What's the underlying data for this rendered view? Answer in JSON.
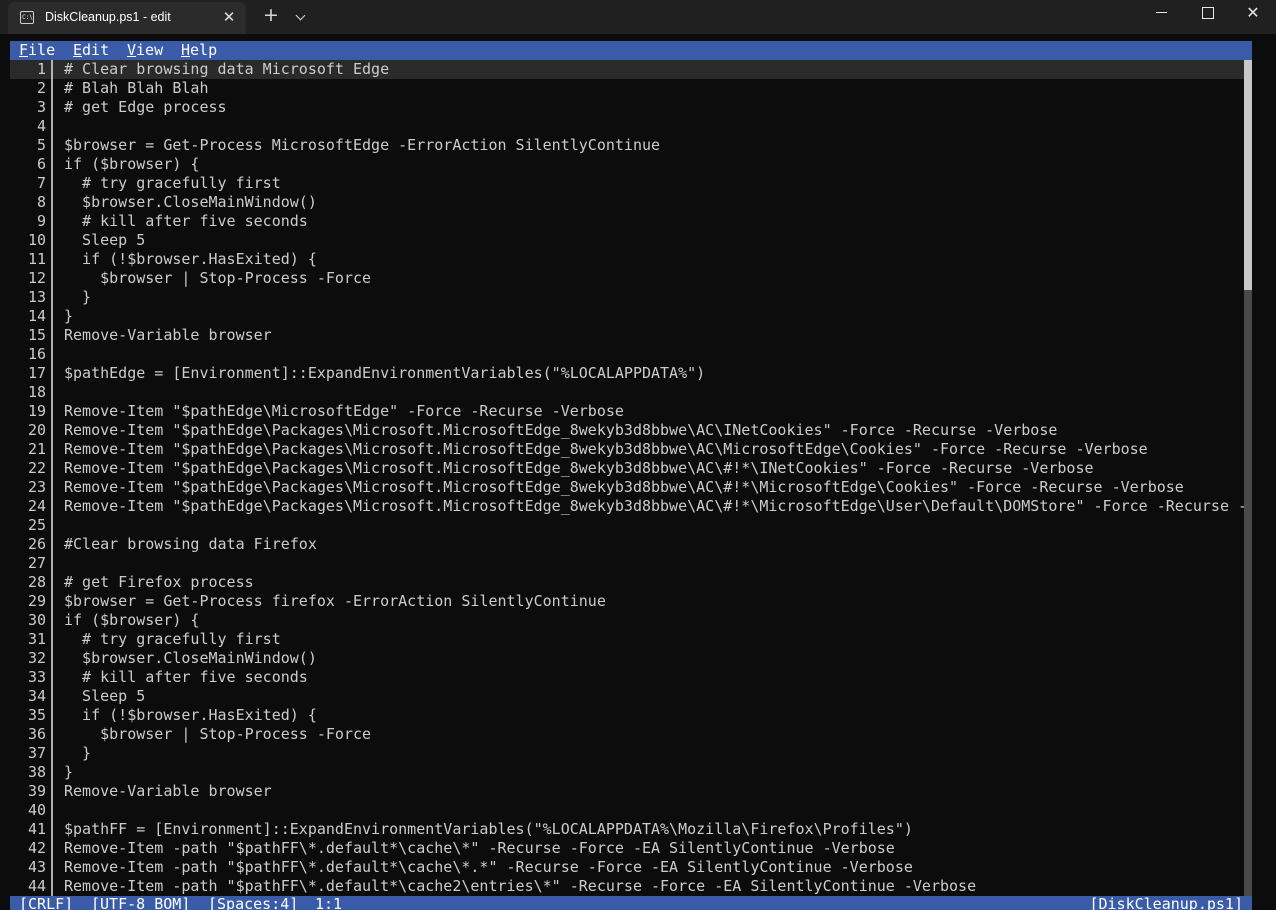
{
  "window": {
    "tab_title": "DiskCleanup.ps1 - edit",
    "tab_icon_text": "C:\\",
    "new_tab_glyph": "+",
    "close_glyph": "✕",
    "win_close_glyph": "✕"
  },
  "menu": {
    "items": [
      {
        "mnemonic": "F",
        "rest": "ile"
      },
      {
        "mnemonic": "E",
        "rest": "dit"
      },
      {
        "mnemonic": "V",
        "rest": "iew"
      },
      {
        "mnemonic": "H",
        "rest": "elp"
      }
    ]
  },
  "editor": {
    "current_line": 1,
    "scroll_thumb_fraction": [
      0,
      0.275
    ],
    "lines": [
      "# Clear browsing data Microsoft Edge",
      "# Blah Blah Blah",
      "# get Edge process",
      "",
      "$browser = Get-Process MicrosoftEdge -ErrorAction SilentlyContinue",
      "if ($browser) {",
      "  # try gracefully first",
      "  $browser.CloseMainWindow()",
      "  # kill after five seconds",
      "  Sleep 5",
      "  if (!$browser.HasExited) {",
      "    $browser | Stop-Process -Force",
      "  }",
      "}",
      "Remove-Variable browser",
      "",
      "$pathEdge = [Environment]::ExpandEnvironmentVariables(\"%LOCALAPPDATA%\")",
      "",
      "Remove-Item \"$pathEdge\\MicrosoftEdge\" -Force -Recurse -Verbose",
      "Remove-Item \"$pathEdge\\Packages\\Microsoft.MicrosoftEdge_8wekyb3d8bbwe\\AC\\INetCookies\" -Force -Recurse -Verbose",
      "Remove-Item \"$pathEdge\\Packages\\Microsoft.MicrosoftEdge_8wekyb3d8bbwe\\AC\\MicrosoftEdge\\Cookies\" -Force -Recurse -Verbose",
      "Remove-Item \"$pathEdge\\Packages\\Microsoft.MicrosoftEdge_8wekyb3d8bbwe\\AC\\#!*\\INetCookies\" -Force -Recurse -Verbose",
      "Remove-Item \"$pathEdge\\Packages\\Microsoft.MicrosoftEdge_8wekyb3d8bbwe\\AC\\#!*\\MicrosoftEdge\\Cookies\" -Force -Recurse -Verbose",
      "Remove-Item \"$pathEdge\\Packages\\Microsoft.MicrosoftEdge_8wekyb3d8bbwe\\AC\\#!*\\MicrosoftEdge\\User\\Default\\DOMStore\" -Force -Recurse -",
      "",
      "#Clear browsing data Firefox",
      "",
      "# get Firefox process",
      "$browser = Get-Process firefox -ErrorAction SilentlyContinue",
      "if ($browser) {",
      "  # try gracefully first",
      "  $browser.CloseMainWindow()",
      "  # kill after five seconds",
      "  Sleep 5",
      "  if (!$browser.HasExited) {",
      "    $browser | Stop-Process -Force",
      "  }",
      "}",
      "Remove-Variable browser",
      "",
      "$pathFF = [Environment]::ExpandEnvironmentVariables(\"%LOCALAPPDATA%\\Mozilla\\Firefox\\Profiles\")",
      "Remove-Item -path \"$pathFF\\*.default*\\cache\\*\" -Recurse -Force -EA SilentlyContinue -Verbose",
      "Remove-Item -path \"$pathFF\\*.default*\\cache\\*.*\" -Recurse -Force -EA SilentlyContinue -Verbose",
      "Remove-Item -path \"$pathFF\\*.default*\\cache2\\entries\\*\" -Recurse -Force -EA SilentlyContinue -Verbose"
    ]
  },
  "status": {
    "line_ending": "[CRLF]",
    "encoding": "[UTF-8 BOM]",
    "indent": "[Spaces:4]",
    "cursor": "1:1",
    "filename": "[DiskCleanup.ps1]"
  },
  "colors": {
    "accent": "#3a5ca8",
    "background": "#0c0c0c",
    "text": "#cccccc"
  }
}
